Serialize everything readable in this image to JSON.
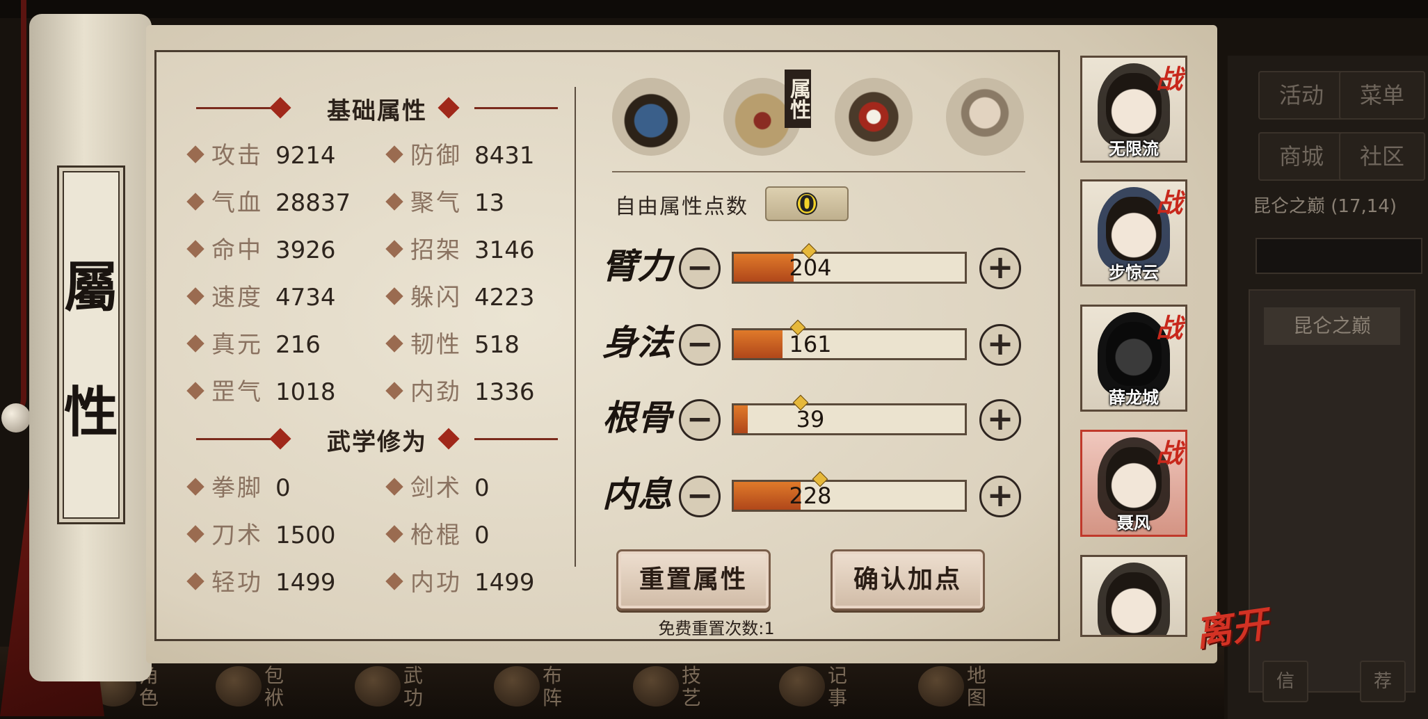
{
  "scroll": {
    "label_top": "屬",
    "label_bottom": "性"
  },
  "base_attributes": {
    "title": "基础属性",
    "stats": [
      {
        "name": "攻击",
        "value": "9214"
      },
      {
        "name": "防御",
        "value": "8431"
      },
      {
        "name": "气血",
        "value": "28837"
      },
      {
        "name": "聚气",
        "value": "13"
      },
      {
        "name": "命中",
        "value": "3926"
      },
      {
        "name": "招架",
        "value": "3146"
      },
      {
        "name": "速度",
        "value": "4734"
      },
      {
        "name": "躲闪",
        "value": "4223"
      },
      {
        "name": "真元",
        "value": "216"
      },
      {
        "name": "韧性",
        "value": "518"
      },
      {
        "name": "罡气",
        "value": "1018"
      },
      {
        "name": "内劲",
        "value": "1336"
      }
    ]
  },
  "martial_skills": {
    "title": "武学修为",
    "stats": [
      {
        "name": "拳脚",
        "value": "0"
      },
      {
        "name": "剑术",
        "value": "0"
      },
      {
        "name": "刀术",
        "value": "1500"
      },
      {
        "name": "枪棍",
        "value": "0"
      },
      {
        "name": "轻功",
        "value": "1499"
      },
      {
        "name": "内功",
        "value": "1499"
      }
    ]
  },
  "tabs": {
    "icons": [
      "hat-icon",
      "scroll-icon",
      "bagua-icon",
      "body-icon"
    ],
    "active_tag": "属性"
  },
  "free_points": {
    "label": "自由属性点数",
    "value": "0"
  },
  "attributes": [
    {
      "name": "臂力",
      "value": "204",
      "fill": 0.26
    },
    {
      "name": "身法",
      "value": "161",
      "fill": 0.21
    },
    {
      "name": "根骨",
      "value": "39",
      "fill": 0.06
    },
    {
      "name": "内息",
      "value": "228",
      "fill": 0.29
    }
  ],
  "buttons": {
    "reset": "重置属性",
    "confirm": "确认加点"
  },
  "reset_count": "免费重置次数:1",
  "party": [
    {
      "name": "无限流",
      "badge": "战",
      "selected": false
    },
    {
      "name": "步惊云",
      "badge": "战",
      "selected": false
    },
    {
      "name": "薛龙城",
      "badge": "战",
      "selected": false
    },
    {
      "name": "聂风",
      "badge": "战",
      "selected": true
    },
    {
      "name": "",
      "badge": "",
      "selected": false
    }
  ],
  "leave_label": "离开",
  "right_panel": {
    "buttons": [
      "活动",
      "菜单",
      "商城",
      "社区"
    ],
    "location": "昆仑之巅 (17,14)",
    "location_tag": "昆仑之巅",
    "bottom_buttons": [
      "信",
      "荐"
    ]
  },
  "bottom_nav": [
    {
      "label": "角色"
    },
    {
      "label": "包袱"
    },
    {
      "label": "武功"
    },
    {
      "label": "布阵"
    },
    {
      "label": "技艺"
    },
    {
      "label": "记事"
    },
    {
      "label": "地图"
    }
  ]
}
